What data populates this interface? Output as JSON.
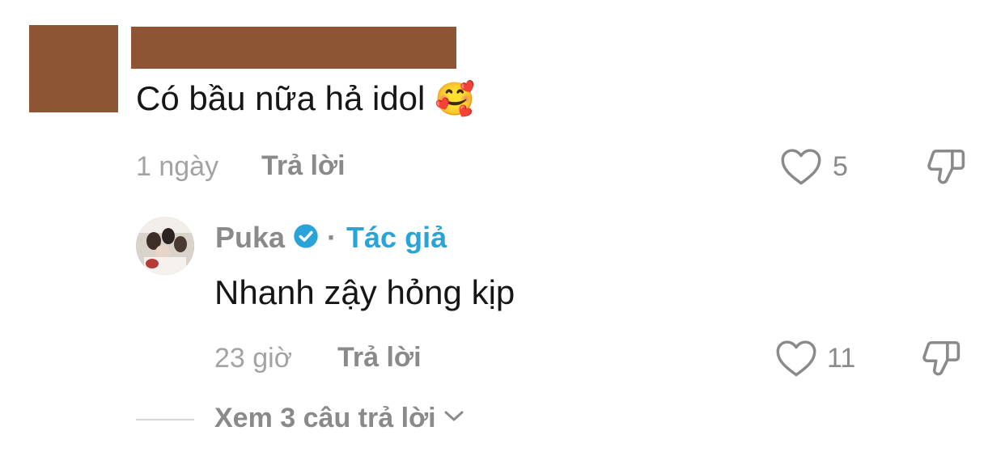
{
  "comment": {
    "text": "Có bầu nữa hả idol",
    "emoji": "🥰",
    "time": "1 ngày",
    "reply_label": "Trả lời",
    "like_count": "5"
  },
  "reply": {
    "author": "Puka",
    "separator": "·",
    "author_tag": "Tác giả",
    "text": "Nhanh zậy hỏng kịp",
    "time": "23 giờ",
    "reply_label": "Trả lời",
    "like_count": "11"
  },
  "view_more": {
    "label": "Xem 3 câu trả lời"
  },
  "colors": {
    "redaction": "#8e5535",
    "verified": "#2aa3d8",
    "muted": "#8a8a8a"
  },
  "icons": [
    "heart-icon",
    "dislike-icon",
    "verified-badge-icon",
    "chevron-down-icon"
  ]
}
